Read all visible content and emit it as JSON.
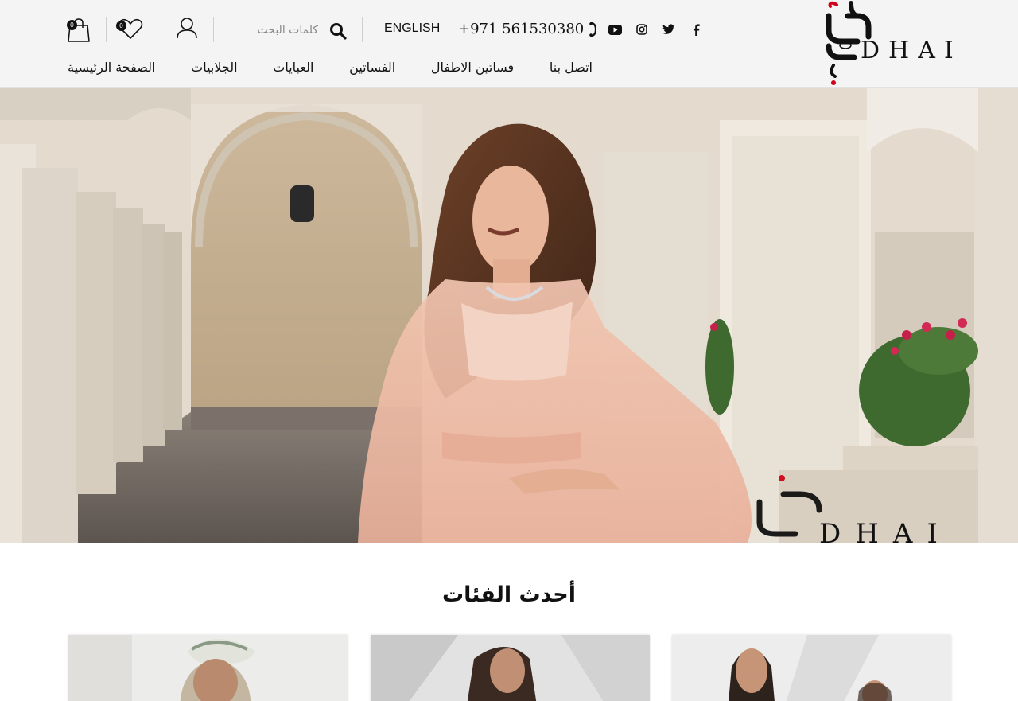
{
  "brand": {
    "name": "DHAI"
  },
  "header": {
    "phone": "+971 561530380",
    "language_label": "ENGLISH",
    "search_placeholder": "كلمات البحث",
    "wishlist_count": "0",
    "cart_count": "0",
    "socials": [
      "facebook-icon",
      "twitter-icon",
      "instagram-icon",
      "youtube-icon"
    ]
  },
  "nav": {
    "items": [
      {
        "label": "الصفحة الرئيسية"
      },
      {
        "label": "الجلابيات"
      },
      {
        "label": "العبايات"
      },
      {
        "label": "الفساتين"
      },
      {
        "label": "فساتين الاطفال"
      },
      {
        "label": "اتصل بنا"
      }
    ]
  },
  "hero": {
    "watermark": "DHAI"
  },
  "categories": {
    "title": "أحدث الفئات"
  },
  "colors": {
    "header_bg": "#f4f4f4",
    "text": "#111111",
    "accent_red": "#d0021b"
  }
}
